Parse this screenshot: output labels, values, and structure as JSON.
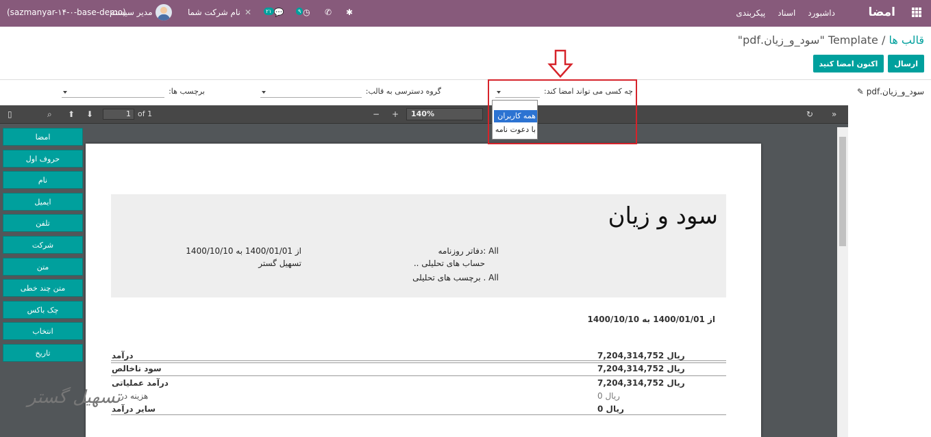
{
  "topbar": {
    "brand": "امضا",
    "menu": [
      "داشبورد",
      "اسناد",
      "پیکربندی"
    ],
    "company": "نام شرکت شما",
    "user": "مدیر سیستم",
    "db": "(sazmanyar-۱۴-۰-base-demo)",
    "badge_chat": "۲۱",
    "badge_activity": "۹"
  },
  "breadcrumb": {
    "parent": "قالب ها",
    "current": "Template \"سود_و_زیان.pdf\""
  },
  "buttons": {
    "send": "ارسال",
    "sign_now": "اکنون امضا کنید"
  },
  "filters": {
    "pdf_name": "سود_و_زیان.pdf",
    "who_can_sign": "چه کسی می تواند امضا کند:",
    "access_group": "گروه دسترسی به قالب:",
    "tags": "برچسب ها:"
  },
  "dropdown": {
    "options": [
      "همه کاربران",
      "با دعوت نامه"
    ],
    "selected": "همه کاربران"
  },
  "toolbar": {
    "page": "1",
    "of": "of 1",
    "zoom": "140%"
  },
  "fields": [
    "امضا",
    "حروف اول",
    "نام",
    "ایمیل",
    "تلفن",
    "شرکت",
    "متن",
    "متن چند خطی",
    "چک باکس",
    "انتخاب",
    "تاریخ"
  ],
  "report": {
    "title": "سود و زیان",
    "journals": "All :دفاتر روزنامه",
    "analytic": "حساب های تحلیلی ..",
    "tags": "All . برچسب های تحلیلی",
    "period": "از 1400/01/01 به 1400/10/10",
    "partner": "تسهیل گستر",
    "period2": "از 1400/01/01 به 1400/10/10",
    "rows": [
      {
        "label": "درآمد",
        "amount": "ریال 7,204,314,752",
        "bold": true
      },
      {
        "label": "سود ناخالص",
        "amount": "ریال 7,204,314,752",
        "bold": true
      },
      {
        "label": "درآمد عملیاتی",
        "amount": "ریال 7,204,314,752",
        "bold": true
      },
      {
        "label": "هزینه در",
        "amount": "ریال 0",
        "bold": false
      },
      {
        "label": "سایر درآمد",
        "amount": "ریال 0",
        "bold": true
      }
    ]
  },
  "watermark": "تسهیل گستر"
}
